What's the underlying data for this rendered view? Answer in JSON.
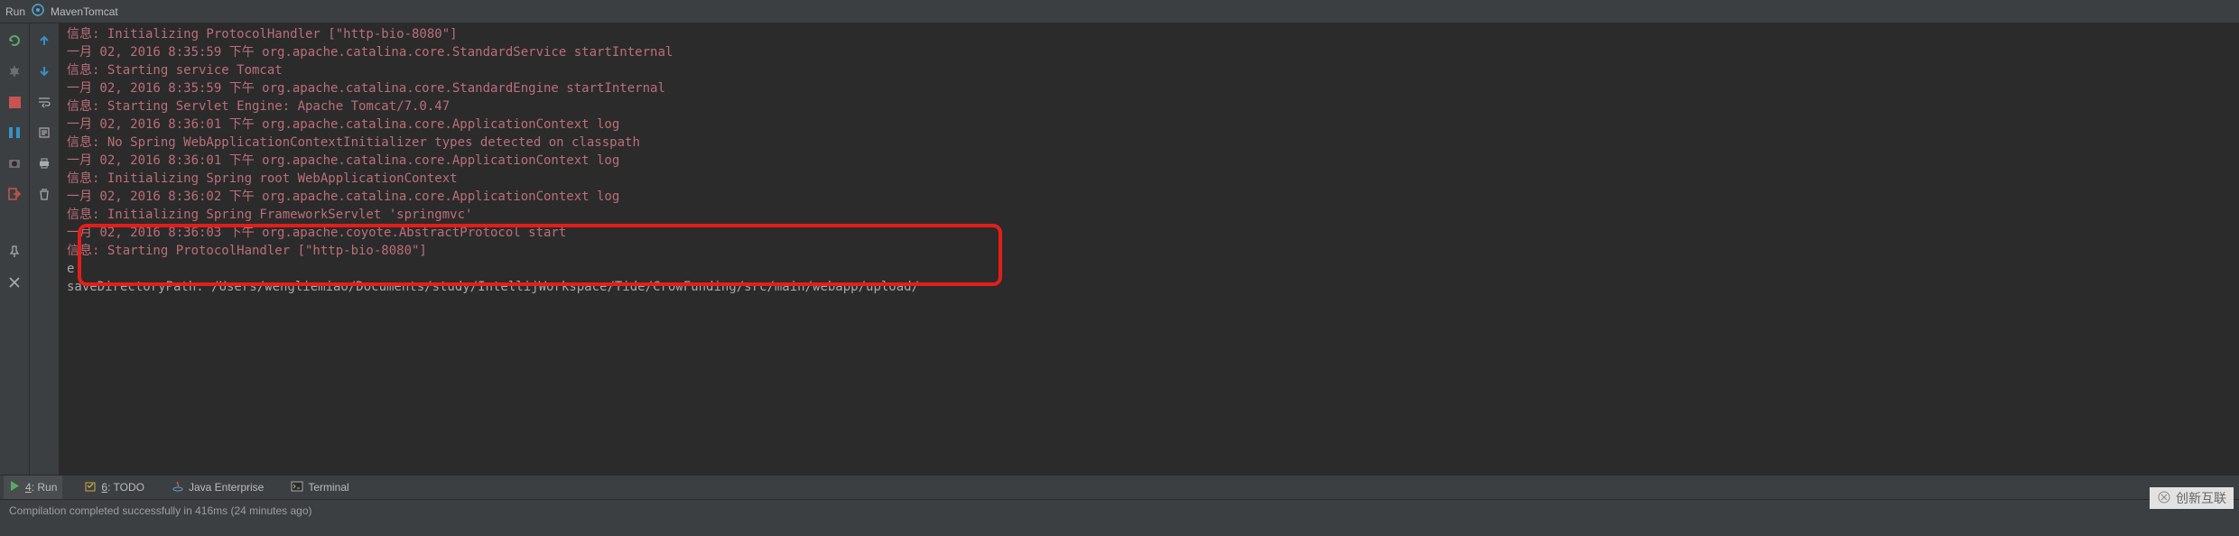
{
  "header": {
    "run": "Run",
    "config": "MavenTomcat"
  },
  "console": {
    "lines": [
      {
        "c": "red",
        "t": "信息: Initializing ProtocolHandler [\"http-bio-8080\"]"
      },
      {
        "c": "red",
        "t": "一月 02, 2016 8:35:59 下午 org.apache.catalina.core.StandardService startInternal"
      },
      {
        "c": "red",
        "t": "信息: Starting service Tomcat"
      },
      {
        "c": "red",
        "t": "一月 02, 2016 8:35:59 下午 org.apache.catalina.core.StandardEngine startInternal"
      },
      {
        "c": "red",
        "t": "信息: Starting Servlet Engine: Apache Tomcat/7.0.47"
      },
      {
        "c": "red",
        "t": "一月 02, 2016 8:36:01 下午 org.apache.catalina.core.ApplicationContext log"
      },
      {
        "c": "red",
        "t": "信息: No Spring WebApplicationContextInitializer types detected on classpath"
      },
      {
        "c": "red",
        "t": "一月 02, 2016 8:36:01 下午 org.apache.catalina.core.ApplicationContext log"
      },
      {
        "c": "red",
        "t": "信息: Initializing Spring root WebApplicationContext"
      },
      {
        "c": "red",
        "t": "一月 02, 2016 8:36:02 下午 org.apache.catalina.core.ApplicationContext log"
      },
      {
        "c": "red",
        "t": "信息: Initializing Spring FrameworkServlet 'springmvc'"
      },
      {
        "c": "red",
        "t": "一月 02, 2016 8:36:03 下午 org.apache.coyote.AbstractProtocol start"
      },
      {
        "c": "red",
        "t": "信息: Starting ProtocolHandler [\"http-bio-8080\"]"
      },
      {
        "c": "normal",
        "t": "e"
      },
      {
        "c": "normal",
        "t": "saveDirectoryPath: /Users/wengliemiao/Documents/study/IntellijWorkspace/Tide/CrowFunding/src/main/webapp/upload/"
      }
    ]
  },
  "tabs": {
    "run": {
      "num": "4",
      "label": ": Run"
    },
    "todo": {
      "num": "6",
      "label": ": TODO"
    },
    "java": "Java Enterprise",
    "terminal": "Terminal"
  },
  "status": "Compilation completed successfully in 416ms (24 minutes ago)",
  "watermark": "创新互联"
}
